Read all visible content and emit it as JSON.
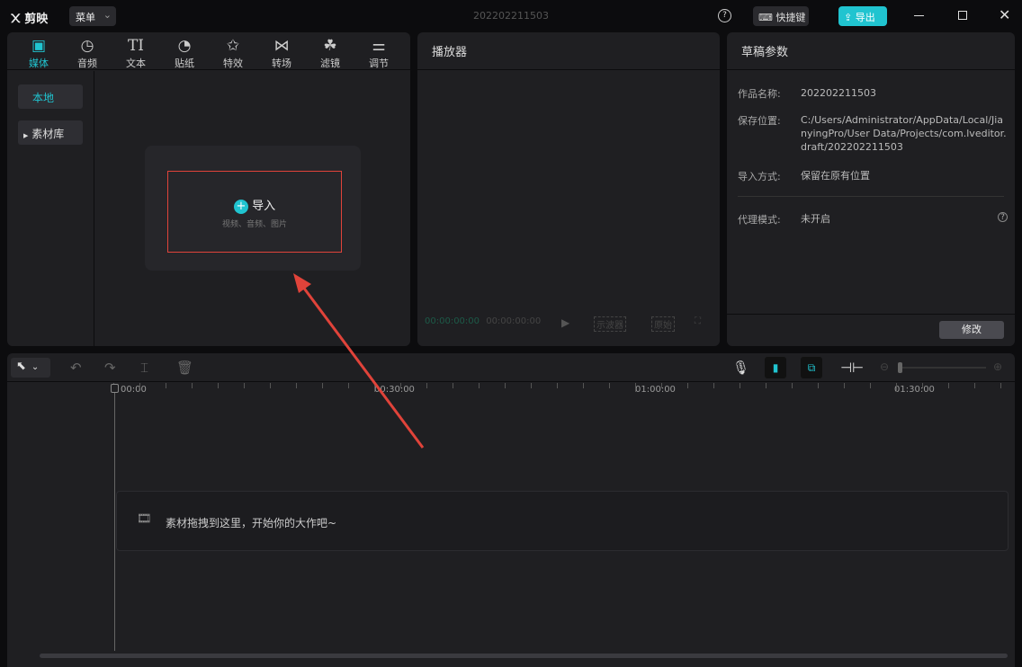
{
  "app": {
    "name": "剪映",
    "menu": "菜单",
    "title": "202202211503",
    "shortcut": "快捷键",
    "export": "导出"
  },
  "media_tabs": [
    {
      "label": "媒体",
      "icon": "media-icon"
    },
    {
      "label": "音频",
      "icon": "audio-icon"
    },
    {
      "label": "文本",
      "icon": "text-icon"
    },
    {
      "label": "贴纸",
      "icon": "sticker-icon"
    },
    {
      "label": "特效",
      "icon": "effects-icon"
    },
    {
      "label": "转场",
      "icon": "transition-icon"
    },
    {
      "label": "滤镜",
      "icon": "filter-icon"
    },
    {
      "label": "调节",
      "icon": "adjust-icon"
    }
  ],
  "media_side": {
    "local": "本地",
    "library": "素材库"
  },
  "import": {
    "label": "导入",
    "sub": "视频、音频、图片"
  },
  "player": {
    "title": "播放器",
    "time_current": "00:00:00:00",
    "time_total": "00:00:00:00",
    "scope": "示波器",
    "ratio": "原始"
  },
  "draft": {
    "title": "草稿参数",
    "name_label": "作品名称:",
    "name": "202202211503",
    "path_label": "保存位置:",
    "path": "C:/Users/Administrator/AppData/Local/JianyingPro/User Data/Projects/com.lveditor.draft/202202211503",
    "import_label": "导入方式:",
    "import_mode": "保留在原有位置",
    "proxy_label": "代理模式:",
    "proxy": "未开启",
    "edit": "修改"
  },
  "timeline": {
    "ticks": [
      "00:00",
      "00:30:00",
      "01:00:00",
      "01:30:00"
    ],
    "placeholder": "素材拖拽到这里，开始你的大作吧~"
  },
  "colors": {
    "accent": "#20c4d0",
    "highlight": "#e0433a"
  }
}
